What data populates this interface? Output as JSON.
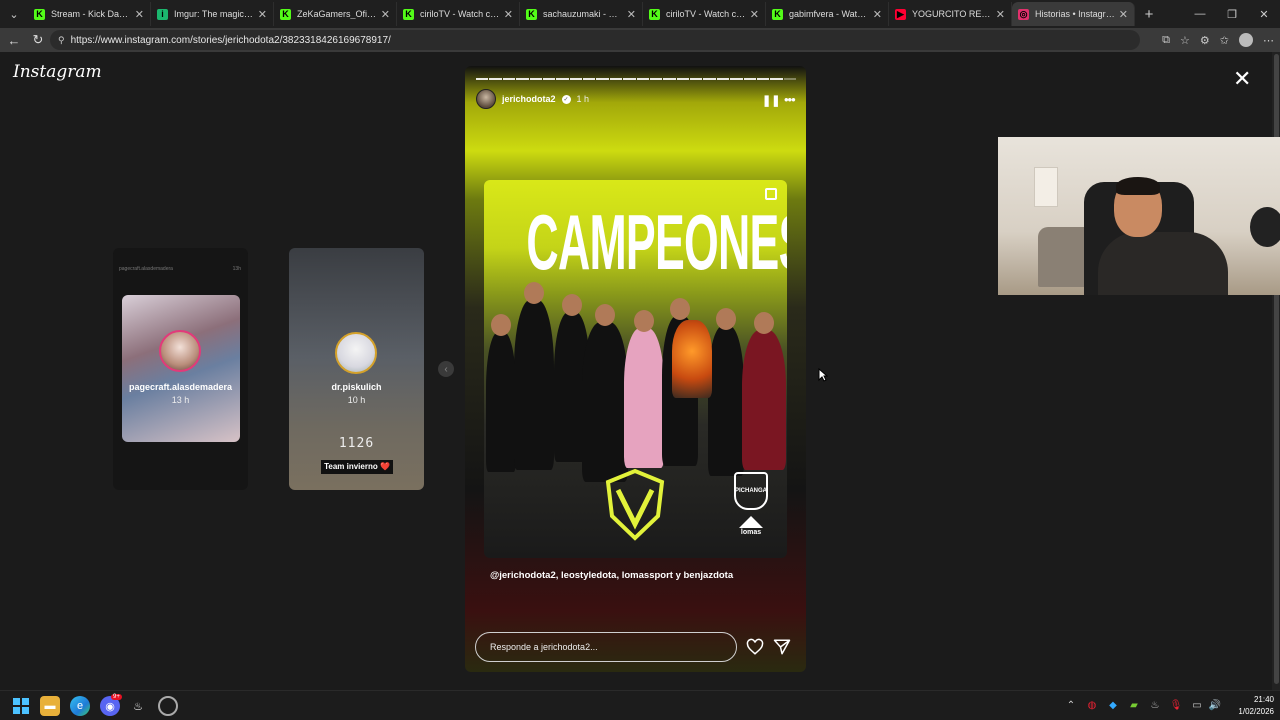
{
  "browser": {
    "tabs": [
      {
        "title": "Stream - Kick Dashboard",
        "fav_color": "#53fc18",
        "fav_glyph": "K"
      },
      {
        "title": "Imgur: The magic of the",
        "fav_color": "#1bb76e",
        "fav_glyph": "i"
      },
      {
        "title": "ZeKaGamers_Oficial - W",
        "fav_color": "#53fc18",
        "fav_glyph": "K"
      },
      {
        "title": "ciriloTV - Watch clips on",
        "fav_color": "#53fc18",
        "fav_glyph": "K"
      },
      {
        "title": "sachauzumaki - Watch c",
        "fav_color": "#53fc18",
        "fav_glyph": "K"
      },
      {
        "title": "ciriloTV - Watch clips on",
        "fav_color": "#53fc18",
        "fav_glyph": "K"
      },
      {
        "title": "gabimfvera - Watch clip",
        "fav_color": "#53fc18",
        "fav_glyph": "K"
      },
      {
        "title": "YOGURCITO REMIX (fea",
        "fav_color": "#ff0033",
        "fav_glyph": "▶"
      },
      {
        "title": "Historias • Instagram",
        "fav_color": "#e1306c",
        "fav_glyph": "◎"
      }
    ],
    "url": "https://www.instagram.com/stories/jerichodota2/3823318426169678917/"
  },
  "instagram": {
    "logo": "Instagram",
    "prev_stories": [
      {
        "mini_user": "pagecraft.alasdemadera",
        "mini_time": "13h",
        "user": "pagecraft.alasdemadera",
        "time": "13 h"
      },
      {
        "user": "dr.piskulich",
        "time": "10 h",
        "counter": "1126",
        "tag": "Team invierno ❤️"
      }
    ],
    "story": {
      "user": "jerichodota2",
      "time": "1 h",
      "poster_title": "CAMPEONES",
      "logo_text_1": "PICHANGA",
      "logo_text_2": "lomas",
      "mentions": "@jerichodota2, leostyledota, lomassport y benjazdota",
      "reply_placeholder": "Responde a jerichodota2...",
      "segments": 24,
      "current_segment": 24
    }
  },
  "taskbar": {
    "time": "21:40",
    "date": "1/02/2026",
    "discord_badge": "9+"
  },
  "colors": {
    "accent_lime": "#d4e414",
    "ig_ring_pink": "#e23a7a",
    "ig_ring_gold": "#d4a12a"
  }
}
